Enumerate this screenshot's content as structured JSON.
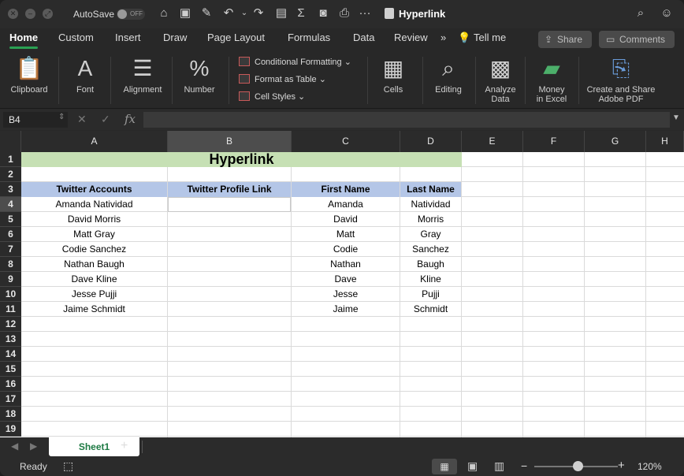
{
  "titlebar": {
    "autosave_label": "AutoSave",
    "autosave_state": "OFF",
    "doc_title": "Hyperlink"
  },
  "tabs": [
    "Home",
    "Custom",
    "Insert",
    "Draw",
    "Page Layout",
    "Formulas",
    "Data",
    "Review",
    "Tell me"
  ],
  "share_label": "Share",
  "comments_label": "Comments",
  "ribbon": {
    "clipboard": "Clipboard",
    "font": "Font",
    "alignment": "Alignment",
    "number": "Number",
    "conditional": "Conditional Formatting",
    "format_table": "Format as Table",
    "cell_styles": "Cell Styles",
    "cells": "Cells",
    "editing": "Editing",
    "analyze1": "Analyze",
    "analyze2": "Data",
    "money1": "Money",
    "money2": "in Excel",
    "adobe1": "Create and Share",
    "adobe2": "Adobe PDF"
  },
  "formula_bar": {
    "name_box": "B4",
    "fx": "fx",
    "value": ""
  },
  "columns": [
    "A",
    "B",
    "C",
    "D",
    "E",
    "F",
    "G",
    "H"
  ],
  "rows": [
    "1",
    "2",
    "3",
    "4",
    "5",
    "6",
    "7",
    "8",
    "9",
    "10",
    "11",
    "12",
    "13",
    "14",
    "15",
    "16",
    "17",
    "18",
    "19"
  ],
  "sheet": {
    "title": "Hyperlink",
    "headers": [
      "Twitter Accounts",
      "Twitter Profile Link",
      "First Name",
      "Last Name"
    ],
    "data": [
      [
        "Amanda Natividad",
        "",
        "Amanda",
        "Natividad"
      ],
      [
        "David Morris",
        "",
        "David",
        "Morris"
      ],
      [
        "Matt  Gray",
        "",
        "Matt",
        "Gray"
      ],
      [
        "Codie Sanchez",
        "",
        "Codie",
        "Sanchez"
      ],
      [
        "Nathan Baugh",
        "",
        "Nathan",
        "Baugh"
      ],
      [
        "Dave Kline",
        "",
        "Dave",
        "Kline"
      ],
      [
        "Jesse Pujji",
        "",
        "Jesse",
        "Pujji"
      ],
      [
        "Jaime Schmidt",
        "",
        "Jaime",
        "Schmidt"
      ]
    ]
  },
  "sheet_tab": "Sheet1",
  "add_sheet": "+",
  "status": {
    "ready": "Ready",
    "zoom": "120%",
    "zoom_fraction": 0.55,
    "zoom_minus": "−",
    "zoom_plus": "+"
  },
  "colors": {
    "title_fill": "#c6e0b4",
    "header_fill": "#b4c6e7",
    "accent": "#2aa153"
  }
}
